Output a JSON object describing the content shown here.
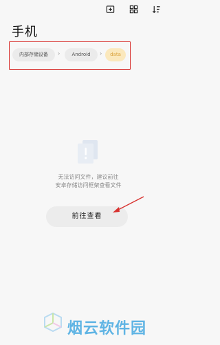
{
  "toolbar": {
    "icons": [
      "add-folder-icon",
      "grid-view-icon",
      "sort-icon"
    ]
  },
  "page_title": "手机",
  "breadcrumb": {
    "items": [
      {
        "label": "内部存储设备",
        "active": false
      },
      {
        "label": "Android",
        "active": false
      },
      {
        "label": "data",
        "active": true
      }
    ]
  },
  "empty_state": {
    "line1": "无法访问文件，建议前往",
    "line2": "安卓存储访问框架查看文件",
    "button_label": "前往查看"
  },
  "watermark": {
    "text": "烟云软件园"
  },
  "colors": {
    "highlight_border": "#d8322f",
    "active_crumb_bg": "#fbe8bc",
    "active_crumb_text": "#d9a23b",
    "watermark_blue": "#5fb4e4"
  }
}
